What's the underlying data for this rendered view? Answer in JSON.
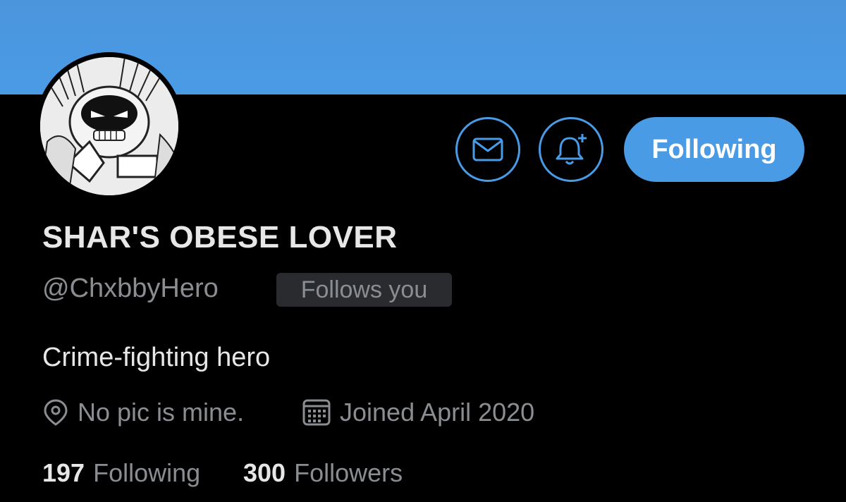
{
  "profile": {
    "display_name": "SHAR'S OBESE LOVER",
    "handle": "@ChxbbyHero",
    "follows_you_badge": "Follows you",
    "bio": "Crime-fighting hero",
    "location": "No pic is mine.",
    "joined": "Joined April 2020",
    "following_count": "197",
    "following_label": "Following",
    "followers_count": "300",
    "followers_label": "Followers"
  },
  "actions": {
    "follow_button_label": "Following",
    "message_icon": "envelope-icon",
    "notify_icon": "bell-plus-icon"
  },
  "colors": {
    "accent": "#4a9be6",
    "background": "#000000",
    "primary_text": "#e7e7e7",
    "secondary_text": "#8a8d91",
    "badge_bg": "#2a2b2e"
  }
}
